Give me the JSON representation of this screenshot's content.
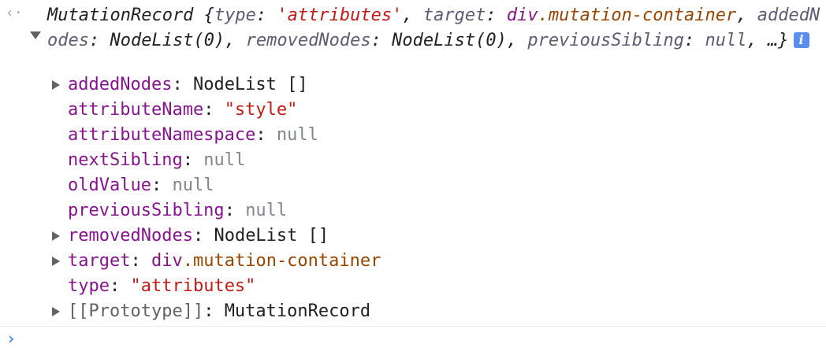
{
  "result_marker": "‹·",
  "header": {
    "class_name": "MutationRecord",
    "open_brace": " {",
    "type_key": "type",
    "type_value": "'attributes'",
    "target_key": "target",
    "target_tag": "div",
    "target_class": ".mutation-container",
    "added_key": "addedNodes",
    "added_value": "NodeList(0)",
    "removed_key": "removedNodes",
    "removed_value": "NodeList(0)",
    "prev_key": "previousSibling",
    "prev_value": "null",
    "ellipsis": "…}",
    "info_icon": "i"
  },
  "properties": [
    {
      "key": "addedNodes",
      "value": "NodeList []",
      "kind": "obj",
      "expandable": true
    },
    {
      "key": "attributeName",
      "value": "\"style\"",
      "kind": "str",
      "expandable": false
    },
    {
      "key": "attributeNamespace",
      "value": "null",
      "kind": "null",
      "expandable": false
    },
    {
      "key": "nextSibling",
      "value": "null",
      "kind": "null",
      "expandable": false
    },
    {
      "key": "oldValue",
      "value": "null",
      "kind": "null",
      "expandable": false
    },
    {
      "key": "previousSibling",
      "value": "null",
      "kind": "null",
      "expandable": false
    },
    {
      "key": "removedNodes",
      "value": "NodeList []",
      "kind": "obj",
      "expandable": true
    },
    {
      "key": "target",
      "value_tag": "div",
      "value_class": ".mutation-container",
      "kind": "node",
      "expandable": true
    },
    {
      "key": "type",
      "value": "\"attributes\"",
      "kind": "str",
      "expandable": false
    },
    {
      "key": "[[Prototype]]",
      "value": "MutationRecord",
      "kind": "obj",
      "expandable": true
    }
  ],
  "prompt": {
    "marker": "›",
    "value": ""
  },
  "colors": {
    "key": "#881391",
    "string": "#c41a16",
    "null": "#80868b",
    "info_badge": "#5b8def",
    "prompt": "#1a73e8"
  }
}
